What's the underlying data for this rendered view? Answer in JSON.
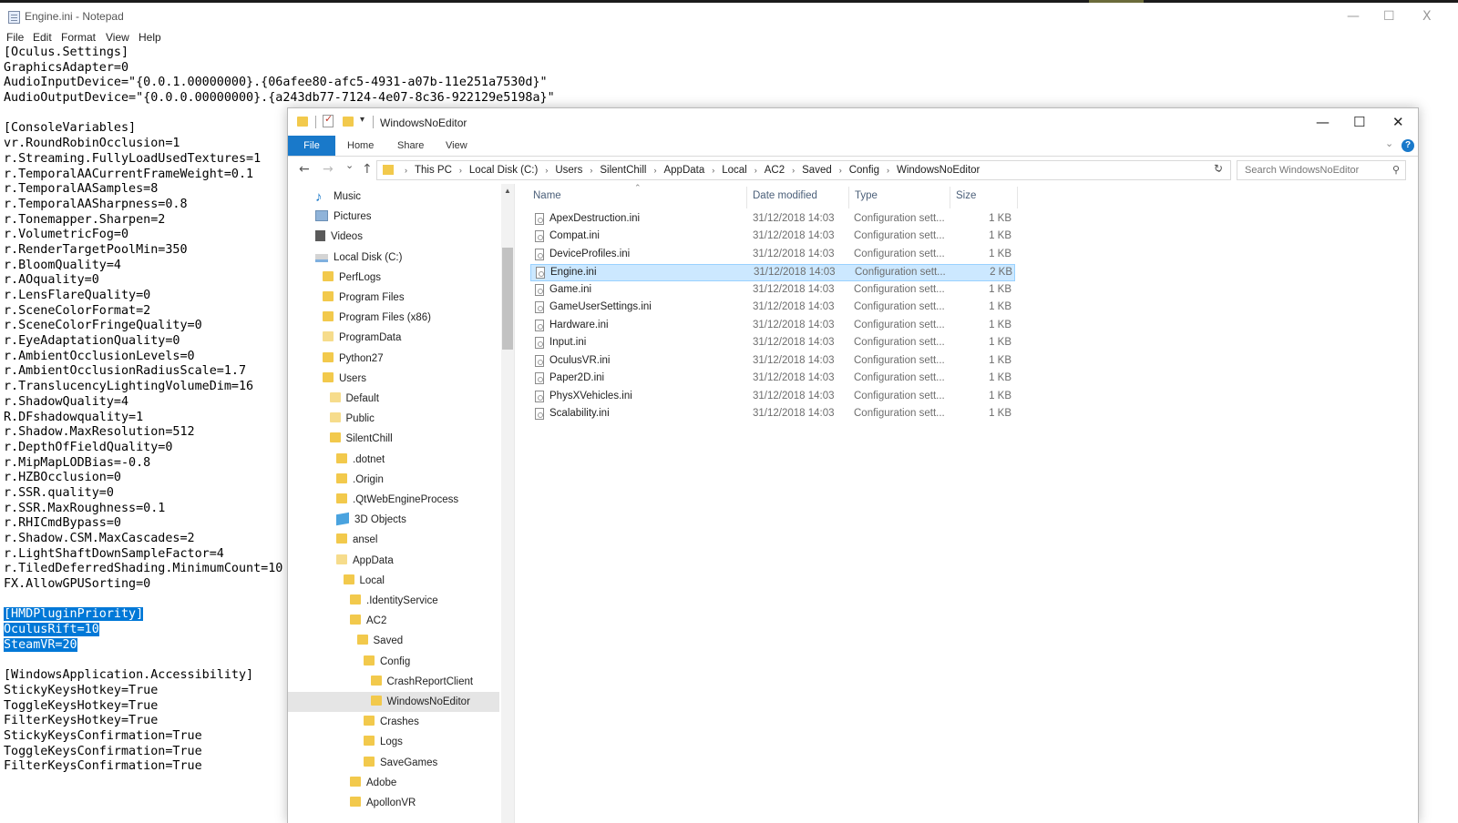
{
  "notepad": {
    "title": "Engine.ini - Notepad",
    "window_controls": {
      "minimize": "—",
      "maximize": "☐",
      "close": "X"
    },
    "menu": [
      "File",
      "Edit",
      "Format",
      "View",
      "Help"
    ],
    "lines": [
      "[Oculus.Settings]",
      "GraphicsAdapter=0",
      "AudioInputDevice=\"{0.0.1.00000000}.{06afee80-afc5-4931-a07b-11e251a7530d}\"",
      "AudioOutputDevice=\"{0.0.0.00000000}.{a243db77-7124-4e07-8c36-922129e5198a}\"",
      "",
      "[ConsoleVariables]",
      "vr.RoundRobinOcclusion=1",
      "r.Streaming.FullyLoadUsedTextures=1",
      "r.TemporalAACurrentFrameWeight=0.1",
      "r.TemporalAASamples=8",
      "r.TemporalAASharpness=0.8",
      "r.Tonemapper.Sharpen=2",
      "r.VolumetricFog=0",
      "r.RenderTargetPoolMin=350",
      "r.BloomQuality=4",
      "r.AOquality=0",
      "r.LensFlareQuality=0",
      "r.SceneColorFormat=2",
      "r.SceneColorFringeQuality=0",
      "r.EyeAdaptationQuality=0",
      "r.AmbientOcclusionLevels=0",
      "r.AmbientOcclusionRadiusScale=1.7",
      "r.TranslucencyLightingVolumeDim=16",
      "r.ShadowQuality=4",
      "R.DFshadowquality=1",
      "r.Shadow.MaxResolution=512",
      "r.DepthOfFieldQuality=0",
      "r.MipMapLODBias=-0.8",
      "r.HZBOcclusion=0",
      "r.SSR.quality=0",
      "r.SSR.MaxRoughness=0.1",
      "r.RHICmdBypass=0",
      "r.Shadow.CSM.MaxCascades=2",
      "r.LightShaftDownSampleFactor=4",
      "r.TiledDeferredShading.MinimumCount=10",
      "FX.AllowGPUSorting=0",
      "",
      "[HMDPluginPriority]",
      "OculusRift=10",
      "SteamVR=20",
      "",
      "[WindowsApplication.Accessibility]",
      "StickyKeysHotkey=True",
      "ToggleKeysHotkey=True",
      "FilterKeysHotkey=True",
      "StickyKeysConfirmation=True",
      "ToggleKeysConfirmation=True",
      "FilterKeysConfirmation=True"
    ],
    "selected_lines": [
      37,
      38,
      39
    ]
  },
  "explorer": {
    "title": "WindowsNoEditor",
    "window_controls": {
      "minimize": "—",
      "maximize": "☐",
      "close": "✕"
    },
    "ribbon": {
      "file": "File",
      "tabs": [
        "Home",
        "Share",
        "View"
      ],
      "help": "?"
    },
    "nav_buttons": {
      "back": "←",
      "forward": "→",
      "recent": "⌄",
      "up": "↑"
    },
    "address": [
      "This PC",
      "Local Disk (C:)",
      "Users",
      "SilentChill",
      "AppData",
      "Local",
      "AC2",
      "Saved",
      "Config",
      "WindowsNoEditor"
    ],
    "search_placeholder": "Search WindowsNoEditor",
    "nav_items": [
      {
        "label": "Music",
        "icon": "music-icon",
        "indent": 0
      },
      {
        "label": "Pictures",
        "icon": "pictures-icon",
        "indent": 0
      },
      {
        "label": "Videos",
        "icon": "videos-icon",
        "indent": 0
      },
      {
        "label": "Local Disk (C:)",
        "icon": "drive-icon",
        "indent": 0
      },
      {
        "label": "PerfLogs",
        "icon": "folder-icon",
        "indent": 1
      },
      {
        "label": "Program Files",
        "icon": "folder-icon",
        "indent": 1
      },
      {
        "label": "Program Files (x86)",
        "icon": "folder-icon",
        "indent": 1
      },
      {
        "label": "ProgramData",
        "icon": "folder-icon",
        "indent": 1
      },
      {
        "label": "Python27",
        "icon": "folder-icon",
        "indent": 1
      },
      {
        "label": "Users",
        "icon": "folder-icon",
        "indent": 1
      },
      {
        "label": "Default",
        "icon": "folder-icon",
        "indent": 2
      },
      {
        "label": "Public",
        "icon": "folder-icon",
        "indent": 2
      },
      {
        "label": "SilentChill",
        "icon": "folder-icon",
        "indent": 2
      },
      {
        "label": ".dotnet",
        "icon": "folder-icon",
        "indent": 3
      },
      {
        "label": ".Origin",
        "icon": "folder-icon",
        "indent": 3
      },
      {
        "label": ".QtWebEngineProcess",
        "icon": "folder-icon",
        "indent": 3
      },
      {
        "label": "3D Objects",
        "icon": "3d-objects-icon",
        "indent": 3
      },
      {
        "label": "ansel",
        "icon": "folder-icon",
        "indent": 3
      },
      {
        "label": "AppData",
        "icon": "folder-icon",
        "indent": 3
      },
      {
        "label": "Local",
        "icon": "folder-icon",
        "indent": 4
      },
      {
        "label": ".IdentityService",
        "icon": "folder-icon",
        "indent": 5
      },
      {
        "label": "AC2",
        "icon": "folder-icon",
        "indent": 5
      },
      {
        "label": "Saved",
        "icon": "folder-icon",
        "indent": 6
      },
      {
        "label": "Config",
        "icon": "folder-icon",
        "indent": 7
      },
      {
        "label": "CrashReportClient",
        "icon": "folder-icon",
        "indent": 8
      },
      {
        "label": "WindowsNoEditor",
        "icon": "folder-icon",
        "indent": 8,
        "selected": true
      },
      {
        "label": "Crashes",
        "icon": "folder-icon",
        "indent": 7
      },
      {
        "label": "Logs",
        "icon": "folder-icon",
        "indent": 7
      },
      {
        "label": "SaveGames",
        "icon": "folder-icon",
        "indent": 7
      },
      {
        "label": "Adobe",
        "icon": "folder-icon",
        "indent": 5
      },
      {
        "label": "ApollonVR",
        "icon": "folder-icon",
        "indent": 5
      }
    ],
    "columns": [
      "Name",
      "Date modified",
      "Type",
      "Size"
    ],
    "files": [
      {
        "name": "ApexDestruction.ini",
        "date": "31/12/2018 14:03",
        "type": "Configuration sett...",
        "size": "1 KB"
      },
      {
        "name": "Compat.ini",
        "date": "31/12/2018 14:03",
        "type": "Configuration sett...",
        "size": "1 KB"
      },
      {
        "name": "DeviceProfiles.ini",
        "date": "31/12/2018 14:03",
        "type": "Configuration sett...",
        "size": "1 KB"
      },
      {
        "name": "Engine.ini",
        "date": "31/12/2018 14:03",
        "type": "Configuration sett...",
        "size": "2 KB",
        "selected": true
      },
      {
        "name": "Game.ini",
        "date": "31/12/2018 14:03",
        "type": "Configuration sett...",
        "size": "1 KB"
      },
      {
        "name": "GameUserSettings.ini",
        "date": "31/12/2018 14:03",
        "type": "Configuration sett...",
        "size": "1 KB"
      },
      {
        "name": "Hardware.ini",
        "date": "31/12/2018 14:03",
        "type": "Configuration sett...",
        "size": "1 KB"
      },
      {
        "name": "Input.ini",
        "date": "31/12/2018 14:03",
        "type": "Configuration sett...",
        "size": "1 KB"
      },
      {
        "name": "OculusVR.ini",
        "date": "31/12/2018 14:03",
        "type": "Configuration sett...",
        "size": "1 KB"
      },
      {
        "name": "Paper2D.ini",
        "date": "31/12/2018 14:03",
        "type": "Configuration sett...",
        "size": "1 KB"
      },
      {
        "name": "PhysXVehicles.ini",
        "date": "31/12/2018 14:03",
        "type": "Configuration sett...",
        "size": "1 KB"
      },
      {
        "name": "Scalability.ini",
        "date": "31/12/2018 14:03",
        "type": "Configuration sett...",
        "size": "1 KB"
      }
    ]
  }
}
